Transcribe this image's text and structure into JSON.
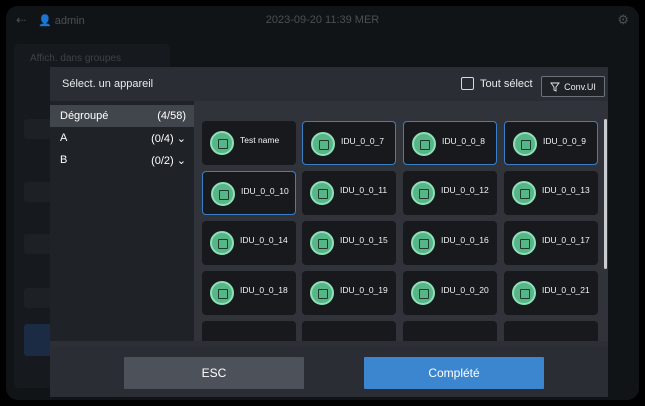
{
  "background": {
    "username": "admin",
    "datetime": "2023-09-20 11:39 MER",
    "label": "Affich. dans groupes"
  },
  "modal": {
    "title": "Sélect. un appareil",
    "select_all_label": "Tout sélect",
    "conv_button_label": "Conv.UI",
    "groups": [
      {
        "name": "Dégroupé",
        "count": "(4/58)",
        "active": true
      },
      {
        "name": "A",
        "count": "(0/4)",
        "chevron": true
      },
      {
        "name": "B",
        "count": "(0/2)",
        "chevron": true
      }
    ],
    "devices": [
      {
        "name": "Test name",
        "selected": false
      },
      {
        "name": "IDU_0_0_7",
        "selected": true
      },
      {
        "name": "IDU_0_0_8",
        "selected": true
      },
      {
        "name": "IDU_0_0_9",
        "selected": true
      },
      {
        "name": "IDU_0_0_10",
        "selected": true
      },
      {
        "name": "IDU_0_0_11",
        "selected": false
      },
      {
        "name": "IDU_0_0_12",
        "selected": false
      },
      {
        "name": "IDU_0_0_13",
        "selected": false
      },
      {
        "name": "IDU_0_0_14",
        "selected": false
      },
      {
        "name": "IDU_0_0_15",
        "selected": false
      },
      {
        "name": "IDU_0_0_16",
        "selected": false
      },
      {
        "name": "IDU_0_0_17",
        "selected": false
      },
      {
        "name": "IDU_0_0_18",
        "selected": false
      },
      {
        "name": "IDU_0_0_19",
        "selected": false
      },
      {
        "name": "IDU_0_0_20",
        "selected": false
      },
      {
        "name": "IDU_0_0_21",
        "selected": false
      }
    ],
    "esc_label": "ESC",
    "complete_label": "Complété"
  },
  "colors": {
    "accent": "#3c85cf",
    "selected_border": "#3a7ec8",
    "device_icon": "#57b688"
  }
}
